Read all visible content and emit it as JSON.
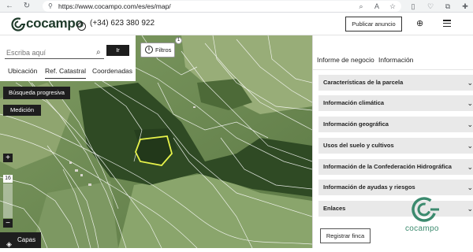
{
  "browser": {
    "url": "https://www.cocampo.com/es/es/map/"
  },
  "header": {
    "logo_text": "cocampo",
    "phone": "(+34) 623 380 922",
    "publish_label": "Publicar anuncio"
  },
  "search": {
    "placeholder": "Escriba aquí",
    "go_label": "Ir",
    "tabs": [
      "Ubicación",
      "Ref. Catastral",
      "Coordenadas"
    ],
    "active_tab": "Ref. Catastral"
  },
  "map": {
    "filter_label": "Filtros",
    "filter_count": "1",
    "progressive_search_label": "Búsqueda progresiva",
    "measure_label": "Medición",
    "zoom_in": "+",
    "zoom_out": "−",
    "zoom_level": "16",
    "layers_label": "Capas"
  },
  "side": {
    "tabs": [
      "Informe de negocio",
      "Información"
    ],
    "active_tab": "Información",
    "sections": [
      "Características de la parcela",
      "Información climática",
      "Información geográfica",
      "Usos del suelo y cultivos",
      "Información de la Confederación Hidrográfica",
      "Información de ayudas y riesgos",
      "Enlaces"
    ],
    "register_label": "Registrar finca",
    "brand_word": "cocampo"
  },
  "colors": {
    "brand": "#3b8a6e",
    "dark": "#1e1e1e",
    "accordion_bg": "#e9e9e9",
    "parcel_highlight": "#e6f24a"
  }
}
